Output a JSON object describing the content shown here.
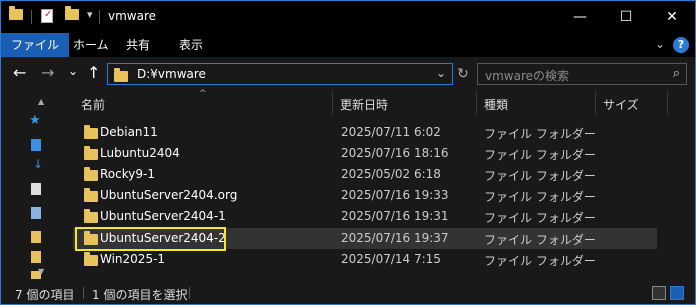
{
  "window": {
    "title": "vmware",
    "minimize_glyph": "—",
    "maximize_glyph": "☐",
    "close_glyph": "✕"
  },
  "ribbon": {
    "tabs": [
      {
        "label": "ファイル",
        "active": true
      },
      {
        "label": "ホーム",
        "active": false
      },
      {
        "label": "共有",
        "active": false
      },
      {
        "label": "表示",
        "active": false
      }
    ],
    "help_glyph": "?"
  },
  "nav": {
    "back_glyph": "←",
    "forward_glyph": "→",
    "recent_glyph": "⌄",
    "up_glyph": "↑",
    "address": "D:¥vmware",
    "refresh_glyph": "↻",
    "search_placeholder": "vmwareの検索"
  },
  "columns": {
    "name": "名前",
    "modified": "更新日時",
    "type": "種類",
    "size": "サイズ"
  },
  "files": [
    {
      "name": "Debian11",
      "modified": "2025/07/11 6:02",
      "type": "ファイル フォルダー"
    },
    {
      "name": "Lubuntu2404",
      "modified": "2025/07/16 18:16",
      "type": "ファイル フォルダー"
    },
    {
      "name": "Rocky9-1",
      "modified": "2025/05/02 6:18",
      "type": "ファイル フォルダー"
    },
    {
      "name": "UbuntuServer2404.org",
      "modified": "2025/07/16 19:33",
      "type": "ファイル フォルダー"
    },
    {
      "name": "UbuntuServer2404-1",
      "modified": "2025/07/16 19:31",
      "type": "ファイル フォルダー"
    },
    {
      "name": "UbuntuServer2404-2",
      "modified": "2025/07/16 19:37",
      "type": "ファイル フォルダー",
      "selected": true
    },
    {
      "name": "Win2025-1",
      "modified": "2025/07/14 7:15",
      "type": "ファイル フォルダー"
    }
  ],
  "status": {
    "item_count": "7 個の項目",
    "selected_count": "1 個の項目を選択"
  },
  "colors": {
    "accent": "#2b7bd6",
    "highlight_box": "#f4e827",
    "folder": "#e8c35c",
    "background": "#191919"
  }
}
